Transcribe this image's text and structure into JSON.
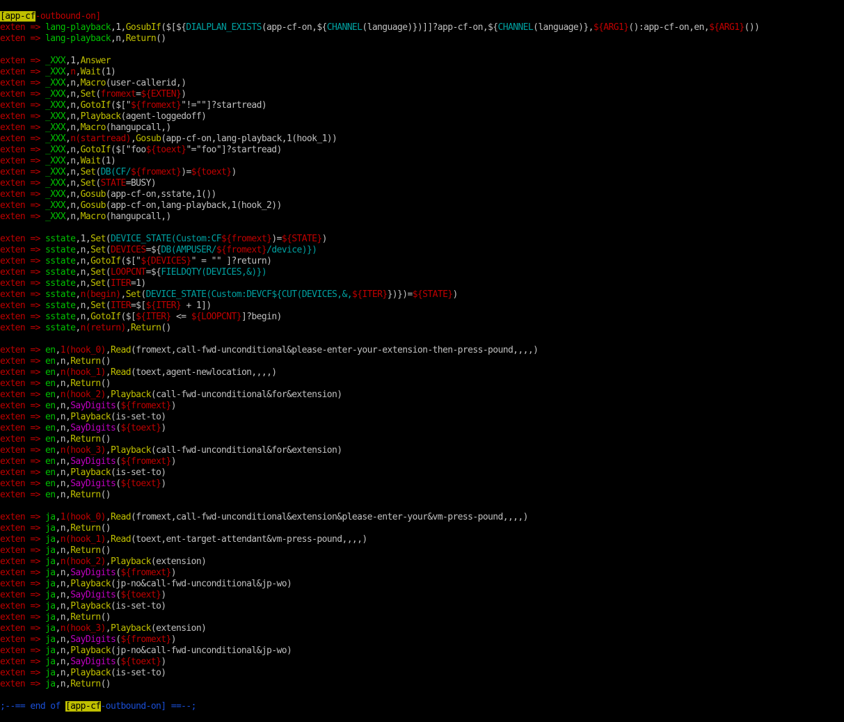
{
  "colors": {
    "background": "#000000",
    "keyword": "#c00000",
    "green": "#00c000",
    "yellow": "#c0c000",
    "cyan": "#00a0a0",
    "magenta": "#c000c0",
    "gray": "#c0c0c0",
    "blue": "#1a4fd8",
    "highlight_bg": "#c0c000",
    "highlight_fg": "#000000"
  },
  "lines": [
    [
      [
        "[app-cf",
        "hl"
      ],
      [
        "-outbound-on]",
        "k"
      ]
    ],
    [
      [
        "exten => ",
        "k"
      ],
      [
        "lang-playback",
        "g"
      ],
      [
        ",1,",
        "w"
      ],
      [
        "GosubIf",
        "y"
      ],
      [
        "($[${",
        "w"
      ],
      [
        "DIALPLAN_EXISTS",
        "c"
      ],
      [
        "(app-cf-on,${",
        "w"
      ],
      [
        "CHANNEL",
        "c"
      ],
      [
        "(language)})]]?app-cf-on,${",
        "w"
      ],
      [
        "CHANNEL",
        "c"
      ],
      [
        "(language)},",
        "w"
      ],
      [
        "${ARG1}",
        "k"
      ],
      [
        "():app-cf-on,en,",
        "w"
      ],
      [
        "${ARG1}",
        "k"
      ],
      [
        "())",
        "w"
      ]
    ],
    [
      [
        "exten => ",
        "k"
      ],
      [
        "lang-playback",
        "g"
      ],
      [
        ",n,",
        "w"
      ],
      [
        "Return",
        "y"
      ],
      [
        "()",
        "w"
      ]
    ],
    [],
    [
      [
        "exten => ",
        "k"
      ],
      [
        "_XXX",
        "g"
      ],
      [
        ",1,",
        "w"
      ],
      [
        "Answer",
        "y"
      ]
    ],
    [
      [
        "exten => ",
        "k"
      ],
      [
        "_XXX",
        "g"
      ],
      [
        ",",
        "w"
      ],
      [
        "n",
        "k"
      ],
      [
        ",",
        "w"
      ],
      [
        "Wait",
        "y"
      ],
      [
        "(1)",
        "w"
      ]
    ],
    [
      [
        "exten => ",
        "k"
      ],
      [
        "_XXX",
        "g"
      ],
      [
        ",n,",
        "w"
      ],
      [
        "Macro",
        "y"
      ],
      [
        "(user-callerid,)",
        "w"
      ]
    ],
    [
      [
        "exten => ",
        "k"
      ],
      [
        "_XXX",
        "g"
      ],
      [
        ",n,",
        "w"
      ],
      [
        "Set",
        "y"
      ],
      [
        "(",
        "w"
      ],
      [
        "fromext",
        "k"
      ],
      [
        "=",
        "w"
      ],
      [
        "${EXTEN}",
        "k"
      ],
      [
        ")",
        "w"
      ]
    ],
    [
      [
        "exten => ",
        "k"
      ],
      [
        "_XXX",
        "g"
      ],
      [
        ",n,",
        "w"
      ],
      [
        "GotoIf",
        "y"
      ],
      [
        "($[\"",
        "w"
      ],
      [
        "${fromext}",
        "k"
      ],
      [
        "\"!=\"\"]?startread)",
        "w"
      ]
    ],
    [
      [
        "exten => ",
        "k"
      ],
      [
        "_XXX",
        "g"
      ],
      [
        ",n,",
        "w"
      ],
      [
        "Playback",
        "y"
      ],
      [
        "(agent-loggedoff)",
        "w"
      ]
    ],
    [
      [
        "exten => ",
        "k"
      ],
      [
        "_XXX",
        "g"
      ],
      [
        ",n,",
        "w"
      ],
      [
        "Macro",
        "y"
      ],
      [
        "(hangupcall,)",
        "w"
      ]
    ],
    [
      [
        "exten => ",
        "k"
      ],
      [
        "_XXX",
        "g"
      ],
      [
        ",",
        "w"
      ],
      [
        "n(startread)",
        "k"
      ],
      [
        ",",
        "w"
      ],
      [
        "Gosub",
        "y"
      ],
      [
        "(app-cf-on,lang-playback,1(hook_1))",
        "w"
      ]
    ],
    [
      [
        "exten => ",
        "k"
      ],
      [
        "_XXX",
        "g"
      ],
      [
        ",n,",
        "w"
      ],
      [
        "GotoIf",
        "y"
      ],
      [
        "($[\"foo",
        "w"
      ],
      [
        "${toext}",
        "k"
      ],
      [
        "\"=\"foo\"]?startread)",
        "w"
      ]
    ],
    [
      [
        "exten => ",
        "k"
      ],
      [
        "_XXX",
        "g"
      ],
      [
        ",n,",
        "w"
      ],
      [
        "Wait",
        "y"
      ],
      [
        "(1)",
        "w"
      ]
    ],
    [
      [
        "exten => ",
        "k"
      ],
      [
        "_XXX",
        "g"
      ],
      [
        ",n,",
        "w"
      ],
      [
        "Set",
        "y"
      ],
      [
        "(",
        "w"
      ],
      [
        "DB",
        "c"
      ],
      [
        "(CF/",
        "c"
      ],
      [
        "${fromext}",
        "k"
      ],
      [
        ")=",
        "w"
      ],
      [
        "${toext}",
        "k"
      ],
      [
        ")",
        "w"
      ]
    ],
    [
      [
        "exten => ",
        "k"
      ],
      [
        "_XXX",
        "g"
      ],
      [
        ",n,",
        "w"
      ],
      [
        "Set",
        "y"
      ],
      [
        "(",
        "w"
      ],
      [
        "STATE",
        "k"
      ],
      [
        "=BUSY)",
        "w"
      ]
    ],
    [
      [
        "exten => ",
        "k"
      ],
      [
        "_XXX",
        "g"
      ],
      [
        ",n,",
        "w"
      ],
      [
        "Gosub",
        "y"
      ],
      [
        "(app-cf-on,sstate,1())",
        "w"
      ]
    ],
    [
      [
        "exten => ",
        "k"
      ],
      [
        "_XXX",
        "g"
      ],
      [
        ",n,",
        "w"
      ],
      [
        "Gosub",
        "y"
      ],
      [
        "(app-cf-on,lang-playback,1(hook_2))",
        "w"
      ]
    ],
    [
      [
        "exten => ",
        "k"
      ],
      [
        "_XXX",
        "g"
      ],
      [
        ",n,",
        "w"
      ],
      [
        "Macro",
        "y"
      ],
      [
        "(hangupcall,)",
        "w"
      ]
    ],
    [],
    [
      [
        "exten => ",
        "k"
      ],
      [
        "sstate",
        "g"
      ],
      [
        ",1,",
        "w"
      ],
      [
        "Set",
        "y"
      ],
      [
        "(",
        "w"
      ],
      [
        "DEVICE_STATE",
        "c"
      ],
      [
        "(Custom:CF",
        "c"
      ],
      [
        "${fromext}",
        "k"
      ],
      [
        ")=",
        "w"
      ],
      [
        "${STATE}",
        "k"
      ],
      [
        ")",
        "w"
      ]
    ],
    [
      [
        "exten => ",
        "k"
      ],
      [
        "sstate",
        "g"
      ],
      [
        ",n,",
        "w"
      ],
      [
        "Set",
        "y"
      ],
      [
        "(",
        "w"
      ],
      [
        "DEVICES",
        "k"
      ],
      [
        "=${",
        "w"
      ],
      [
        "DB",
        "c"
      ],
      [
        "(AMPUSER/",
        "c"
      ],
      [
        "${fromext}",
        "k"
      ],
      [
        "/device)})",
        "c"
      ]
    ],
    [
      [
        "exten => ",
        "k"
      ],
      [
        "sstate",
        "g"
      ],
      [
        ",n,",
        "w"
      ],
      [
        "GotoIf",
        "y"
      ],
      [
        "($[\"",
        "w"
      ],
      [
        "${DEVICES}",
        "k"
      ],
      [
        "\" = \"\" ]?return)",
        "w"
      ]
    ],
    [
      [
        "exten => ",
        "k"
      ],
      [
        "sstate",
        "g"
      ],
      [
        ",n,",
        "w"
      ],
      [
        "Set",
        "y"
      ],
      [
        "(",
        "w"
      ],
      [
        "LOOPCNT",
        "k"
      ],
      [
        "=${",
        "w"
      ],
      [
        "FIELDQTY",
        "c"
      ],
      [
        "(DEVICES,&)})",
        "c"
      ]
    ],
    [
      [
        "exten => ",
        "k"
      ],
      [
        "sstate",
        "g"
      ],
      [
        ",n,",
        "w"
      ],
      [
        "Set",
        "y"
      ],
      [
        "(",
        "w"
      ],
      [
        "ITER",
        "k"
      ],
      [
        "=1)",
        "w"
      ]
    ],
    [
      [
        "exten => ",
        "k"
      ],
      [
        "sstate",
        "g"
      ],
      [
        ",",
        "w"
      ],
      [
        "n(begin)",
        "k"
      ],
      [
        ",",
        "w"
      ],
      [
        "Set",
        "y"
      ],
      [
        "(",
        "w"
      ],
      [
        "DEVICE_STATE",
        "c"
      ],
      [
        "(Custom:DEVCF${",
        "c"
      ],
      [
        "CUT",
        "c"
      ],
      [
        "(DEVICES,&,",
        "c"
      ],
      [
        "${ITER}",
        "k"
      ],
      [
        "})})=",
        "w"
      ],
      [
        "${STATE}",
        "k"
      ],
      [
        ")",
        "w"
      ]
    ],
    [
      [
        "exten => ",
        "k"
      ],
      [
        "sstate",
        "g"
      ],
      [
        ",n,",
        "w"
      ],
      [
        "Set",
        "y"
      ],
      [
        "(",
        "w"
      ],
      [
        "ITER",
        "k"
      ],
      [
        "=$[",
        "w"
      ],
      [
        "${ITER}",
        "k"
      ],
      [
        " + 1])",
        "w"
      ]
    ],
    [
      [
        "exten => ",
        "k"
      ],
      [
        "sstate",
        "g"
      ],
      [
        ",n,",
        "w"
      ],
      [
        "GotoIf",
        "y"
      ],
      [
        "($[",
        "w"
      ],
      [
        "${ITER}",
        "k"
      ],
      [
        " <= ",
        "w"
      ],
      [
        "${LOOPCNT}",
        "k"
      ],
      [
        "]?begin)",
        "w"
      ]
    ],
    [
      [
        "exten => ",
        "k"
      ],
      [
        "sstate",
        "g"
      ],
      [
        ",",
        "w"
      ],
      [
        "n(return)",
        "k"
      ],
      [
        ",",
        "w"
      ],
      [
        "Return",
        "y"
      ],
      [
        "()",
        "w"
      ]
    ],
    [],
    [
      [
        "exten => ",
        "k"
      ],
      [
        "en",
        "g"
      ],
      [
        ",",
        "w"
      ],
      [
        "1(hook_0)",
        "k"
      ],
      [
        ",",
        "w"
      ],
      [
        "Read",
        "y"
      ],
      [
        "(fromext,call-fwd-unconditional&please-enter-your-extension-then-press-pound,,,,)",
        "w"
      ]
    ],
    [
      [
        "exten => ",
        "k"
      ],
      [
        "en",
        "g"
      ],
      [
        ",n,",
        "w"
      ],
      [
        "Return",
        "y"
      ],
      [
        "()",
        "w"
      ]
    ],
    [
      [
        "exten => ",
        "k"
      ],
      [
        "en",
        "g"
      ],
      [
        ",",
        "w"
      ],
      [
        "n(hook_1)",
        "k"
      ],
      [
        ",",
        "w"
      ],
      [
        "Read",
        "y"
      ],
      [
        "(toext,agent-newlocation,,,,)",
        "w"
      ]
    ],
    [
      [
        "exten => ",
        "k"
      ],
      [
        "en",
        "g"
      ],
      [
        ",n,",
        "w"
      ],
      [
        "Return",
        "y"
      ],
      [
        "()",
        "w"
      ]
    ],
    [
      [
        "exten => ",
        "k"
      ],
      [
        "en",
        "g"
      ],
      [
        ",",
        "w"
      ],
      [
        "n(hook_2)",
        "k"
      ],
      [
        ",",
        "w"
      ],
      [
        "Playback",
        "y"
      ],
      [
        "(call-fwd-unconditional&for&extension)",
        "w"
      ]
    ],
    [
      [
        "exten => ",
        "k"
      ],
      [
        "en",
        "g"
      ],
      [
        ",n,",
        "w"
      ],
      [
        "SayDigits",
        "m"
      ],
      [
        "(",
        "w"
      ],
      [
        "${fromext}",
        "k"
      ],
      [
        ")",
        "w"
      ]
    ],
    [
      [
        "exten => ",
        "k"
      ],
      [
        "en",
        "g"
      ],
      [
        ",n,",
        "w"
      ],
      [
        "Playback",
        "y"
      ],
      [
        "(is-set-to)",
        "w"
      ]
    ],
    [
      [
        "exten => ",
        "k"
      ],
      [
        "en",
        "g"
      ],
      [
        ",n,",
        "w"
      ],
      [
        "SayDigits",
        "m"
      ],
      [
        "(",
        "w"
      ],
      [
        "${toext}",
        "k"
      ],
      [
        ")",
        "w"
      ]
    ],
    [
      [
        "exten => ",
        "k"
      ],
      [
        "en",
        "g"
      ],
      [
        ",n,",
        "w"
      ],
      [
        "Return",
        "y"
      ],
      [
        "()",
        "w"
      ]
    ],
    [
      [
        "exten => ",
        "k"
      ],
      [
        "en",
        "g"
      ],
      [
        ",",
        "w"
      ],
      [
        "n(hook_3)",
        "k"
      ],
      [
        ",",
        "w"
      ],
      [
        "Playback",
        "y"
      ],
      [
        "(call-fwd-unconditional&for&extension)",
        "w"
      ]
    ],
    [
      [
        "exten => ",
        "k"
      ],
      [
        "en",
        "g"
      ],
      [
        ",n,",
        "w"
      ],
      [
        "SayDigits",
        "m"
      ],
      [
        "(",
        "w"
      ],
      [
        "${fromext}",
        "k"
      ],
      [
        ")",
        "w"
      ]
    ],
    [
      [
        "exten => ",
        "k"
      ],
      [
        "en",
        "g"
      ],
      [
        ",n,",
        "w"
      ],
      [
        "Playback",
        "y"
      ],
      [
        "(is-set-to)",
        "w"
      ]
    ],
    [
      [
        "exten => ",
        "k"
      ],
      [
        "en",
        "g"
      ],
      [
        ",n,",
        "w"
      ],
      [
        "SayDigits",
        "m"
      ],
      [
        "(",
        "w"
      ],
      [
        "${toext}",
        "k"
      ],
      [
        ")",
        "w"
      ]
    ],
    [
      [
        "exten => ",
        "k"
      ],
      [
        "en",
        "g"
      ],
      [
        ",n,",
        "w"
      ],
      [
        "Return",
        "y"
      ],
      [
        "()",
        "w"
      ]
    ],
    [],
    [
      [
        "exten => ",
        "k"
      ],
      [
        "ja",
        "g"
      ],
      [
        ",",
        "w"
      ],
      [
        "1(hook_0)",
        "k"
      ],
      [
        ",",
        "w"
      ],
      [
        "Read",
        "y"
      ],
      [
        "(fromext,call-fwd-unconditional&extension&please-enter-your&vm-press-pound,,,,)",
        "w"
      ]
    ],
    [
      [
        "exten => ",
        "k"
      ],
      [
        "ja",
        "g"
      ],
      [
        ",n,",
        "w"
      ],
      [
        "Return",
        "y"
      ],
      [
        "()",
        "w"
      ]
    ],
    [
      [
        "exten => ",
        "k"
      ],
      [
        "ja",
        "g"
      ],
      [
        ",",
        "w"
      ],
      [
        "n(hook_1)",
        "k"
      ],
      [
        ",",
        "w"
      ],
      [
        "Read",
        "y"
      ],
      [
        "(toext,ent-target-attendant&vm-press-pound,,,,)",
        "w"
      ]
    ],
    [
      [
        "exten => ",
        "k"
      ],
      [
        "ja",
        "g"
      ],
      [
        ",n,",
        "w"
      ],
      [
        "Return",
        "y"
      ],
      [
        "()",
        "w"
      ]
    ],
    [
      [
        "exten => ",
        "k"
      ],
      [
        "ja",
        "g"
      ],
      [
        ",",
        "w"
      ],
      [
        "n(hook_2)",
        "k"
      ],
      [
        ",",
        "w"
      ],
      [
        "Playback",
        "y"
      ],
      [
        "(extension)",
        "w"
      ]
    ],
    [
      [
        "exten => ",
        "k"
      ],
      [
        "ja",
        "g"
      ],
      [
        ",n,",
        "w"
      ],
      [
        "SayDigits",
        "m"
      ],
      [
        "(",
        "w"
      ],
      [
        "${fromext}",
        "k"
      ],
      [
        ")",
        "w"
      ]
    ],
    [
      [
        "exten => ",
        "k"
      ],
      [
        "ja",
        "g"
      ],
      [
        ",n,",
        "w"
      ],
      [
        "Playback",
        "y"
      ],
      [
        "(jp-no&call-fwd-unconditional&jp-wo)",
        "w"
      ]
    ],
    [
      [
        "exten => ",
        "k"
      ],
      [
        "ja",
        "g"
      ],
      [
        ",n,",
        "w"
      ],
      [
        "SayDigits",
        "m"
      ],
      [
        "(",
        "w"
      ],
      [
        "${toext}",
        "k"
      ],
      [
        ")",
        "w"
      ]
    ],
    [
      [
        "exten => ",
        "k"
      ],
      [
        "ja",
        "g"
      ],
      [
        ",n,",
        "w"
      ],
      [
        "Playback",
        "y"
      ],
      [
        "(is-set-to)",
        "w"
      ]
    ],
    [
      [
        "exten => ",
        "k"
      ],
      [
        "ja",
        "g"
      ],
      [
        ",n,",
        "w"
      ],
      [
        "Return",
        "y"
      ],
      [
        "()",
        "w"
      ]
    ],
    [
      [
        "exten => ",
        "k"
      ],
      [
        "ja",
        "g"
      ],
      [
        ",",
        "w"
      ],
      [
        "n(hook_3)",
        "k"
      ],
      [
        ",",
        "w"
      ],
      [
        "Playback",
        "y"
      ],
      [
        "(extension)",
        "w"
      ]
    ],
    [
      [
        "exten => ",
        "k"
      ],
      [
        "ja",
        "g"
      ],
      [
        ",n,",
        "w"
      ],
      [
        "SayDigits",
        "m"
      ],
      [
        "(",
        "w"
      ],
      [
        "${fromext}",
        "k"
      ],
      [
        ")",
        "w"
      ]
    ],
    [
      [
        "exten => ",
        "k"
      ],
      [
        "ja",
        "g"
      ],
      [
        ",n,",
        "w"
      ],
      [
        "Playback",
        "y"
      ],
      [
        "(jp-no&call-fwd-unconditional&jp-wo)",
        "w"
      ]
    ],
    [
      [
        "exten => ",
        "k"
      ],
      [
        "ja",
        "g"
      ],
      [
        ",n,",
        "w"
      ],
      [
        "SayDigits",
        "m"
      ],
      [
        "(",
        "w"
      ],
      [
        "${toext}",
        "k"
      ],
      [
        ")",
        "w"
      ]
    ],
    [
      [
        "exten => ",
        "k"
      ],
      [
        "ja",
        "g"
      ],
      [
        ",n,",
        "w"
      ],
      [
        "Playback",
        "y"
      ],
      [
        "(is-set-to)",
        "w"
      ]
    ],
    [
      [
        "exten => ",
        "k"
      ],
      [
        "ja",
        "g"
      ],
      [
        ",n,",
        "w"
      ],
      [
        "Return",
        "y"
      ],
      [
        "()",
        "w"
      ]
    ],
    [],
    [
      [
        ";--== end of ",
        "b"
      ],
      [
        "[app-cf",
        "hl"
      ],
      [
        "-outbound-on] ==--;",
        "b"
      ]
    ]
  ]
}
